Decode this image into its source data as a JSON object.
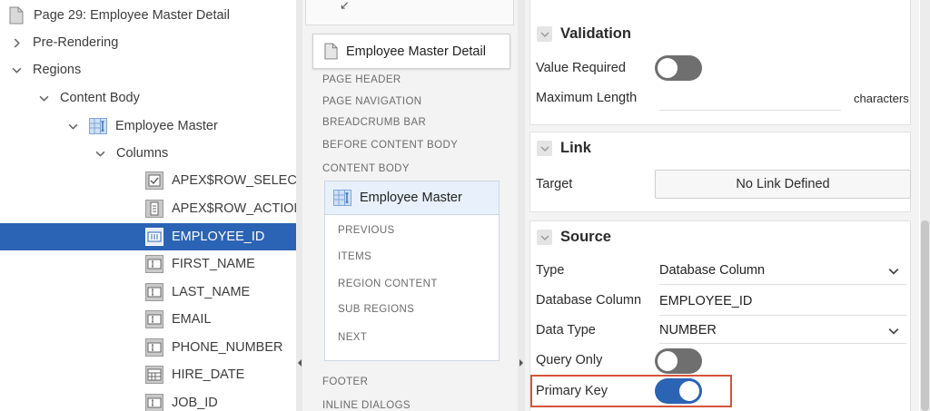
{
  "tree": {
    "items": [
      {
        "label": "Page 29: Employee Master Detail"
      },
      {
        "label": "Pre-Rendering"
      },
      {
        "label": "Regions"
      },
      {
        "label": "Content Body"
      },
      {
        "label": "Employee Master"
      },
      {
        "label": "Columns"
      },
      {
        "label": "APEX$ROW_SELECTOR"
      },
      {
        "label": "APEX$ROW_ACTION"
      },
      {
        "label": "EMPLOYEE_ID"
      },
      {
        "label": "FIRST_NAME"
      },
      {
        "label": "LAST_NAME"
      },
      {
        "label": "EMAIL"
      },
      {
        "label": "PHONE_NUMBER"
      },
      {
        "label": "HIRE_DATE"
      },
      {
        "label": "JOB_ID"
      }
    ]
  },
  "layout": {
    "top_arrow": "↙",
    "page_card": "Employee Master Detail",
    "positions": [
      "PAGE HEADER",
      "PAGE NAVIGATION",
      "BREADCRUMB BAR",
      "BEFORE CONTENT BODY",
      "CONTENT BODY"
    ],
    "region": {
      "title": "Employee Master",
      "sub_positions": [
        "PREVIOUS",
        "ITEMS",
        "REGION CONTENT",
        "SUB REGIONS",
        "NEXT"
      ]
    },
    "bottom_positions": [
      "FOOTER",
      "INLINE DIALOGS"
    ]
  },
  "properties": {
    "validation": {
      "title": "Validation",
      "value_required_label": "Value Required",
      "value_required": false,
      "max_length_label": "Maximum Length",
      "max_length_value": "",
      "max_length_unit": "characters"
    },
    "link": {
      "title": "Link",
      "target_label": "Target",
      "target_value": "No Link Defined"
    },
    "source": {
      "title": "Source",
      "type_label": "Type",
      "type_value": "Database Column",
      "db_column_label": "Database Column",
      "db_column_value": "EMPLOYEE_ID",
      "data_type_label": "Data Type",
      "data_type_value": "NUMBER",
      "query_only_label": "Query Only",
      "query_only": false,
      "primary_key_label": "Primary Key",
      "primary_key": true
    }
  },
  "colors": {
    "selected": "#2b63b5",
    "highlight": "#d4553a"
  }
}
